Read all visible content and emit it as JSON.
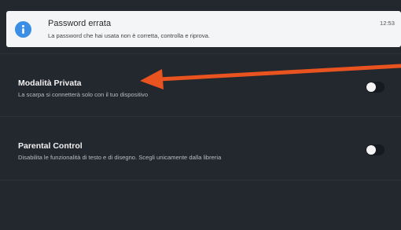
{
  "notification": {
    "icon": "info-icon",
    "title": "Password errata",
    "body": "La password che hai usata non è corretta, controlla e riprova.",
    "time": "12:53",
    "icon_color": "#3a8ee6"
  },
  "settings": [
    {
      "title": "Modalità Privata",
      "description": "La scarpa si connetterà solo con il tuo dispositivo",
      "enabled": false
    },
    {
      "title": "Parental Control",
      "description": "Disabilita le funzionalità di testo e di disegno. Scegli unicamente dalla libreria",
      "enabled": false
    }
  ],
  "colors": {
    "background": "#23272e",
    "annotation_arrow": "#e8531f"
  }
}
